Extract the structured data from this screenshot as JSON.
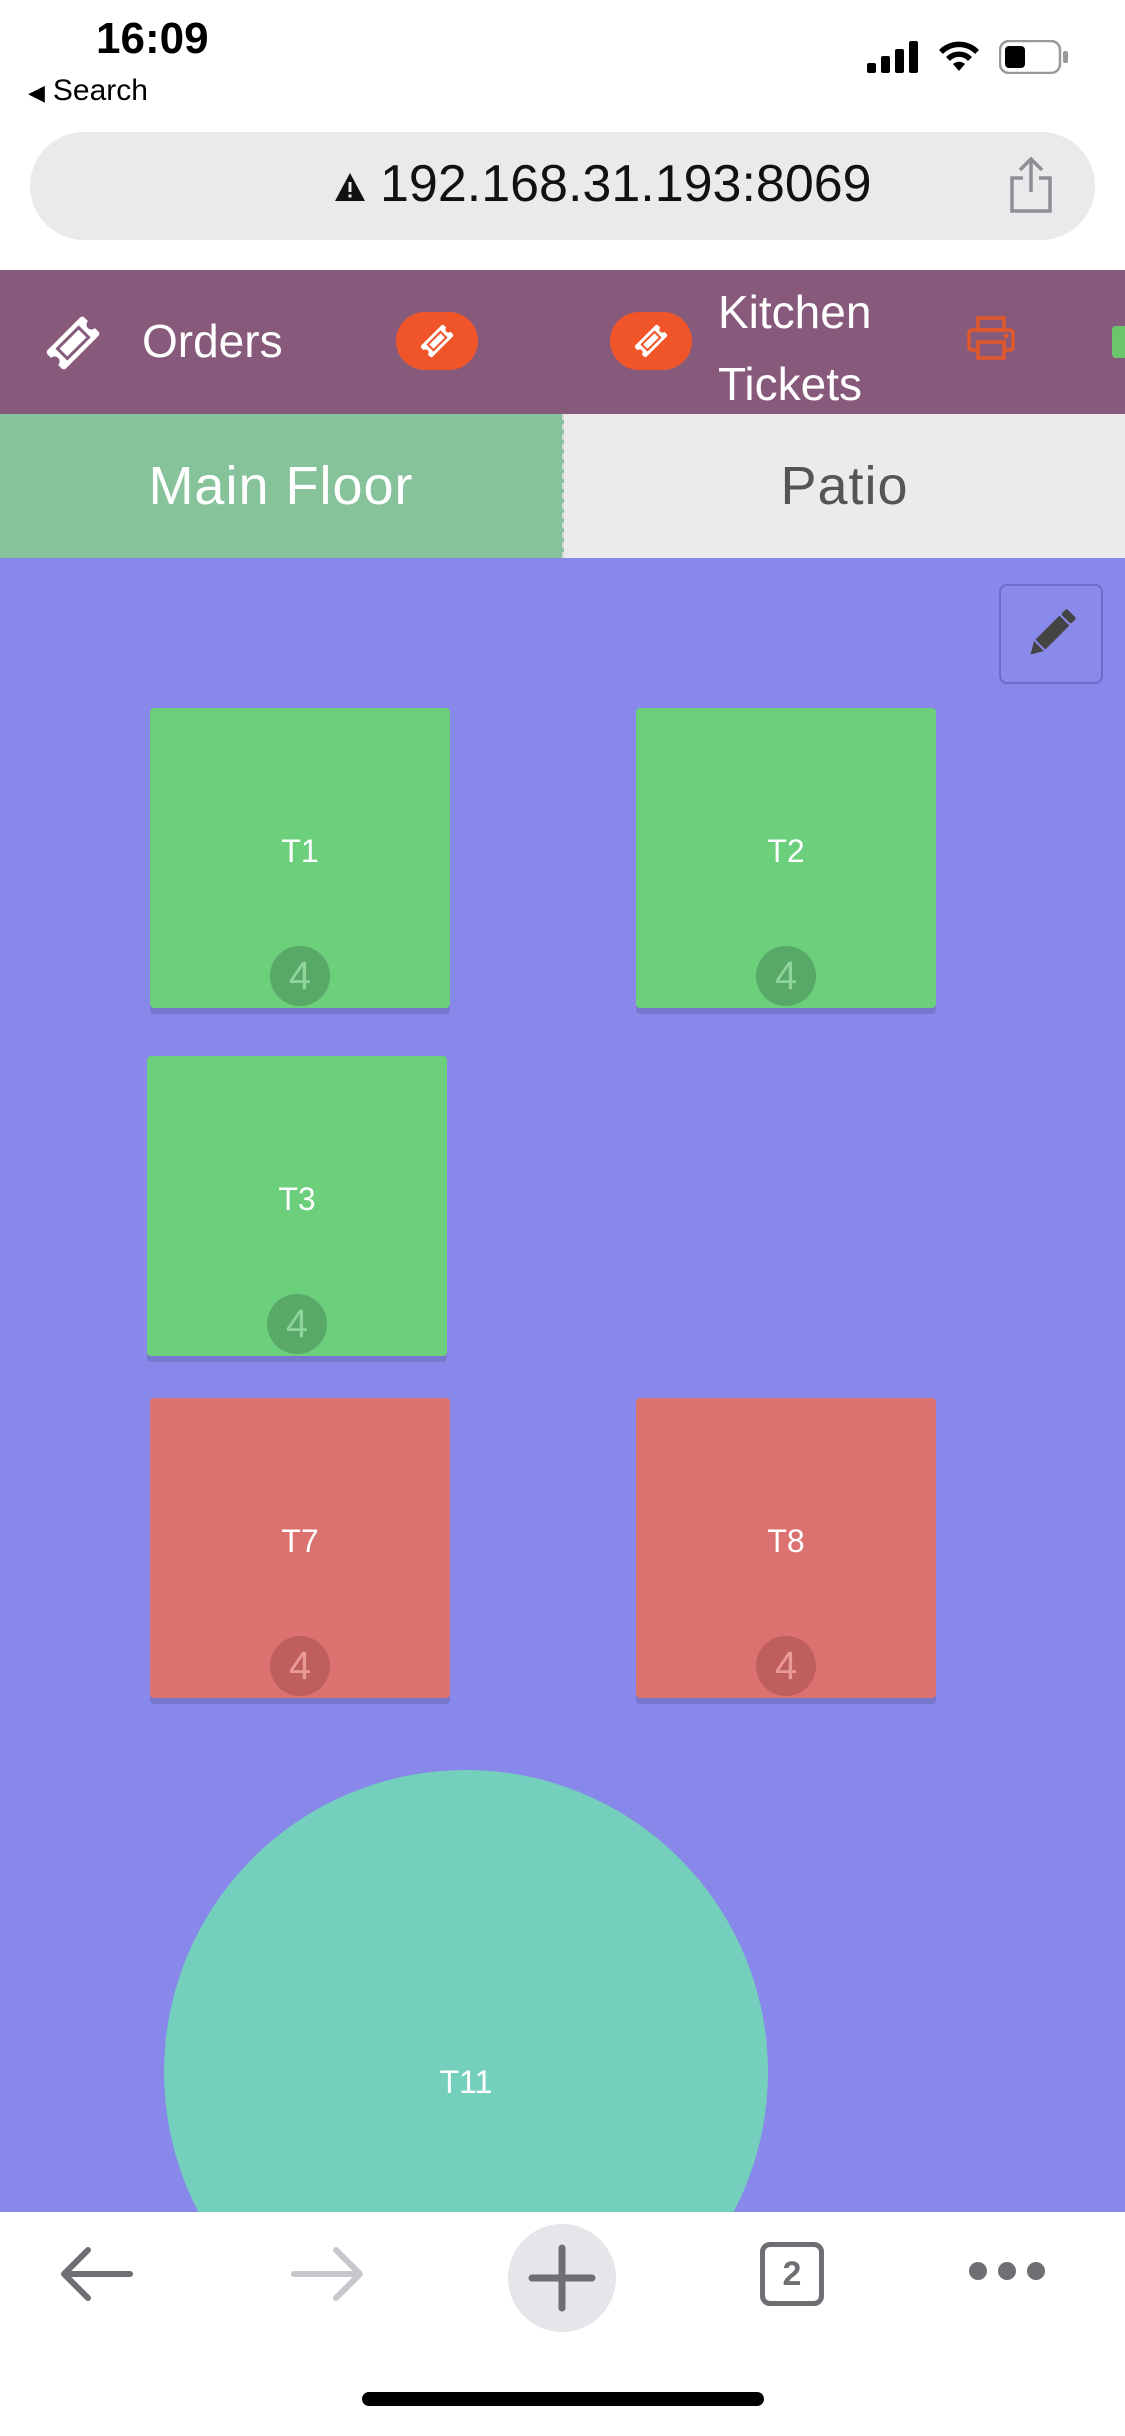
{
  "status_bar": {
    "time": "16:09",
    "back_label": "Search"
  },
  "browser": {
    "url": "192.168.31.193:8069",
    "tab_count": "2"
  },
  "top_nav": {
    "orders_label": "Orders",
    "kitchen_label_line1": "Kitchen",
    "kitchen_label_line2": "Tickets"
  },
  "floor_tabs": [
    {
      "label": "Main Floor",
      "active": true
    },
    {
      "label": "Patio",
      "active": false
    }
  ],
  "tables": [
    {
      "name": "T1",
      "seats": "4",
      "status": "available"
    },
    {
      "name": "T2",
      "seats": "4",
      "status": "available"
    },
    {
      "name": "T3",
      "seats": "4",
      "status": "available"
    },
    {
      "name": "T7",
      "seats": "4",
      "status": "occupied"
    },
    {
      "name": "T8",
      "seats": "4",
      "status": "occupied"
    },
    {
      "name": "T11",
      "shape": "round"
    }
  ],
  "colors": {
    "nav_bg": "#875a7b",
    "accent_orange": "#f0552a",
    "active_tab": "#86c39b",
    "floor_bg": "#8888ea",
    "table_available": "#6bcf7c",
    "table_occupied": "#db726f",
    "table_round": "#74cfbd"
  },
  "icons": [
    "ticket-icon",
    "ticket-badge-icon",
    "printer-icon",
    "pencil-icon",
    "share-icon",
    "warning-icon",
    "back-arrow-icon",
    "forward-arrow-icon",
    "plus-icon",
    "more-icon",
    "signal-icon",
    "wifi-icon",
    "battery-icon"
  ]
}
